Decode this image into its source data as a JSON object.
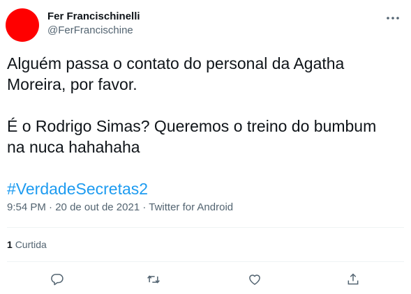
{
  "author": {
    "display_name": "Fer Francischinelli",
    "handle": "@FerFrancischine",
    "avatar_color": "#ff0000"
  },
  "tweet": {
    "line1": "Alguém passa o contato do personal da Agatha Moreira, por favor.",
    "line2": "É o Rodrigo Simas? Queremos o treino do bumbum na nuca hahahaha",
    "hashtag": "#VerdadeSecretas2"
  },
  "meta": {
    "time": "9:54 PM",
    "date": "20 de out de 2021",
    "source": "Twitter for Android",
    "separator": " · "
  },
  "stats": {
    "likes_count": "1",
    "likes_label": "Curtida"
  },
  "actions": {
    "reply_icon": "reply-icon",
    "retweet_icon": "retweet-icon",
    "like_icon": "heart-icon",
    "share_icon": "share-icon"
  },
  "colors": {
    "text": "#0f1419",
    "secondary": "#536471",
    "link": "#1d9bf0",
    "divider": "#eff3f4"
  }
}
